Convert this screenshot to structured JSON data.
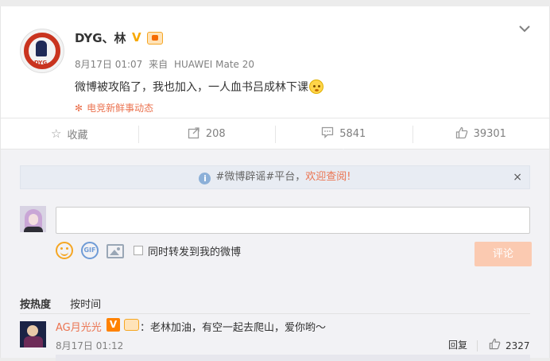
{
  "post": {
    "author": "DYG、林",
    "verified_mark": "V",
    "time": "8月17日 01:07",
    "via_prefix": "来自",
    "device": "HUAWEI Mate 20",
    "content": "微博被攻陷了，我也加入，一人血书吕成林下课",
    "topic": "电竞新鲜事动态",
    "avatar_logo": "DYG"
  },
  "actions": {
    "favorite": "收藏",
    "repost_count": "208",
    "comment_count": "5841",
    "like_count": "39301"
  },
  "comment_box": {
    "notice_prefix": "#微博辟谣#平台，",
    "notice_link": "欢迎查阅!",
    "notice_close": "×",
    "gif_label": "GIF",
    "repost_checkbox_label": "同时转发到我的微博",
    "submit": "评论"
  },
  "sort": {
    "by_hot": "按热度",
    "by_time": "按时间"
  },
  "comments": [
    {
      "user": "AG月光光",
      "verified_mark": "V",
      "text": "：老林加油，有空一起去爬山，爱你哟～",
      "time": "8月17日 01:12",
      "reply_label": "回复",
      "likes": "2327"
    }
  ],
  "icons": {
    "topic": "asterisk-icon",
    "favorite": "star-icon",
    "repost": "share-icon",
    "comment": "comment-icon",
    "like": "thumb-up-icon",
    "more": "chevron-down-icon"
  },
  "colors": {
    "accent": "#eb7350",
    "submit_disabled": "#fbcab1",
    "verified": "#f7a800",
    "link_blue": "#6f9bd6"
  }
}
